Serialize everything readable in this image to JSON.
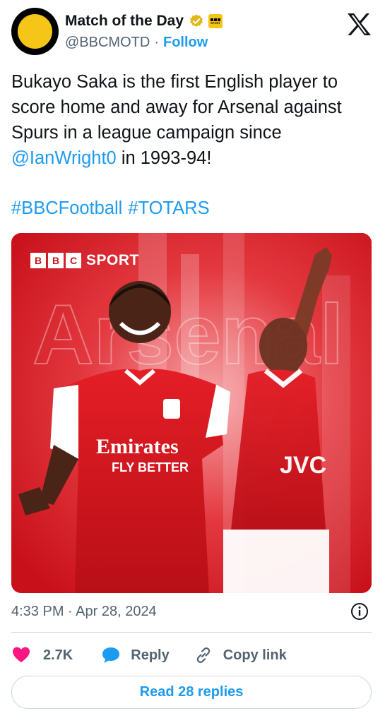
{
  "account": {
    "display_name": "Match of the Day",
    "handle": "@BBCMOTD",
    "separator": "·",
    "follow_label": "Follow"
  },
  "tweet": {
    "text_part1": "Bukayo Saka is the first English player to score home and away for Arsenal against Spurs in a league campaign since ",
    "mention": "@IanWright0",
    "text_part2": " in 1993-94!",
    "hashtags": [
      "#BBCFootball",
      "#TOTARS"
    ]
  },
  "media": {
    "brand_letters": [
      "B",
      "B",
      "C"
    ],
    "brand_word": "SPORT",
    "sponsor_line1": "Emirates",
    "sponsor_line2": "FLY BETTER",
    "sponsor_right": "JVC",
    "background_word": "Arsenal"
  },
  "meta": {
    "timestamp": "4:33 PM · Apr 28, 2024"
  },
  "actions": {
    "likes": "2.7K",
    "reply_label": "Reply",
    "copy_label": "Copy link"
  },
  "read_replies_label": "Read 28 replies",
  "colors": {
    "accent": "#1d9bf0",
    "like": "#f91880",
    "text": "#0f1419",
    "secondary": "#536471",
    "brand_yellow": "#f5c518",
    "arsenal_red": "#d5141b"
  },
  "icons": {
    "avatar": "motd-logo",
    "verified": "verified-badge-icon",
    "affiliate": "bbc-sport-badge",
    "brand": "x-logo-icon",
    "info": "info-icon",
    "like": "heart-icon",
    "reply": "speech-bubble-icon",
    "copy": "link-icon"
  }
}
